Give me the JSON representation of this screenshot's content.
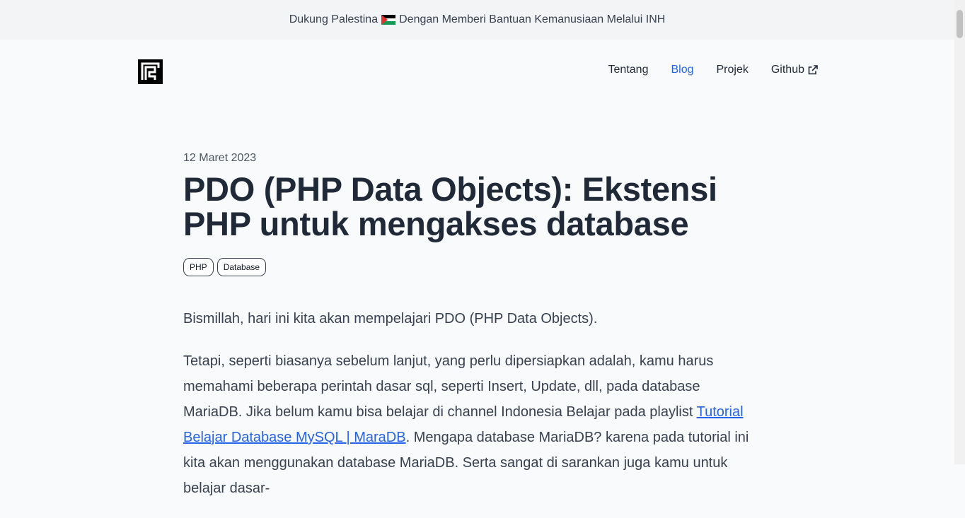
{
  "banner": {
    "text_before": "Dukung Palestina",
    "flag_icon": "palestine-flag-icon",
    "text_after": "Dengan Memberi Bantuan Kemanusiaan Melalui INH"
  },
  "nav": {
    "items": [
      {
        "label": "Tentang"
      },
      {
        "label": "Blog",
        "active": true
      },
      {
        "label": "Projek"
      },
      {
        "label": "Github",
        "icon": "external-link-icon"
      }
    ],
    "active_color": "#2563eb"
  },
  "post": {
    "date": "12 Maret 2023",
    "title": "PDO (PHP Data Objects): Ekstensi PHP untuk mengakses database",
    "tags": [
      "PHP",
      "Database"
    ],
    "intro": "Bismillah, hari ini kita akan mempelajari PDO (PHP Data Objects).",
    "para2_before": "Tetapi, seperti biasanya sebelum lanjut, yang perlu dipersiapkan adalah, kamu harus memahami beberapa perintah dasar sql, seperti Insert, Update, dll, pada database MariaDB. Jika belum kamu bisa belajar di channel Indonesia Belajar pada playlist ",
    "para2_link": "Tutorial Belajar Database MySQL | MaraDB",
    "para2_after": ". Mengapa database MariaDB? karena pada tutorial ini kita akan menggunakan database MariaDB. Serta sangat di sarankan juga kamu untuk belajar dasar-"
  }
}
